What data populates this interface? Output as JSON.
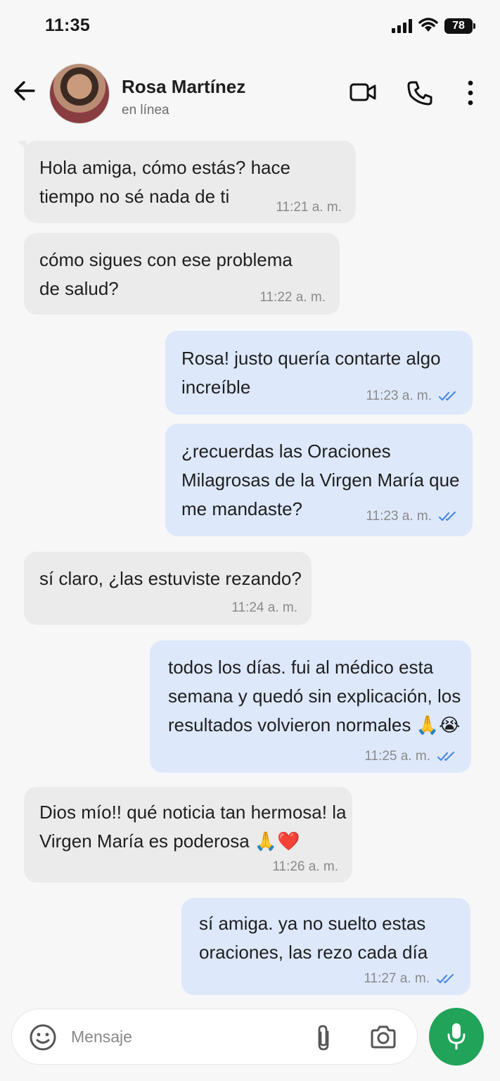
{
  "status_bar": {
    "time": "11:35",
    "battery": "78"
  },
  "header": {
    "contact_name": "Rosa Martínez",
    "contact_status": "en línea"
  },
  "messages": [
    {
      "dir": "in",
      "text": "Hola amiga, cómo estás? hace\ntiempo no sé nada de ti",
      "time": "11:21 a. m."
    },
    {
      "dir": "in",
      "text": "cómo sigues con ese problema\nde salud?",
      "time": "11:22 a. m."
    },
    {
      "dir": "out",
      "text": "Rosa! justo quería contarte algo\nincreíble",
      "time": "11:23 a. m."
    },
    {
      "dir": "out",
      "text": "¿recuerdas las Oraciones\nMilagrosas de la Virgen María que\nme mandaste?",
      "time": "11:23 a. m."
    },
    {
      "dir": "in",
      "text": "sí claro, ¿las estuviste rezando?",
      "time": "11:24 a. m."
    },
    {
      "dir": "out",
      "text": "todos los días. fui al médico esta\nsemana y quedó sin explicación, los\nresultados volvieron normales 🙏😭",
      "time": "11:25 a. m."
    },
    {
      "dir": "in",
      "text": "Dios mío!! qué noticia tan hermosa! la\nVirgen María es poderosa 🙏❤️",
      "time": "11:26 a. m."
    },
    {
      "dir": "out",
      "text": "sí amiga. ya no suelto estas\noraciones, las rezo cada día",
      "time": "11:27 a. m."
    }
  ],
  "composer": {
    "placeholder": "Mensaje"
  },
  "colors": {
    "incoming": "#ebebeb",
    "outgoing": "#dde8fb",
    "accent": "#21a35a",
    "tick": "#4a8ae0"
  },
  "icons": [
    "back-arrow-icon",
    "video-call-icon",
    "phone-icon",
    "more-vertical-icon",
    "emoji-icon",
    "attach-icon",
    "camera-icon",
    "mic-icon",
    "double-check-icon"
  ]
}
